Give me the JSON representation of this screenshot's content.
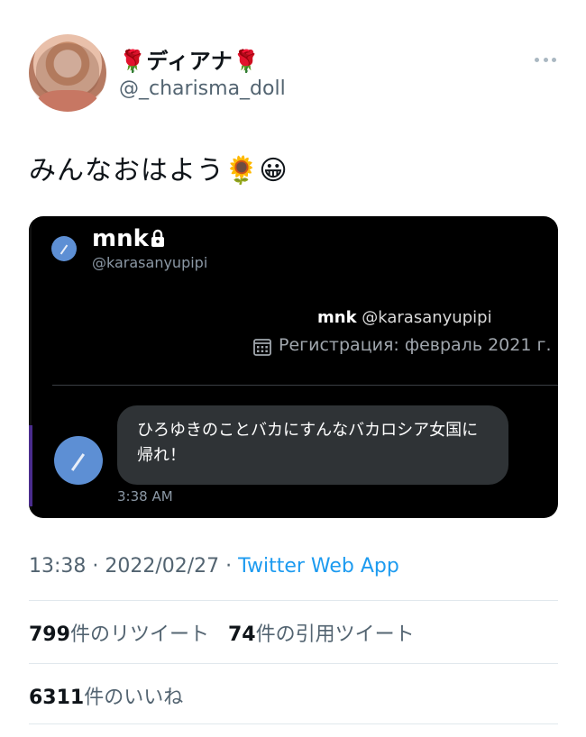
{
  "tweet": {
    "display_name": "🌹ディアナ🌹",
    "username": "@_charisma_doll",
    "text": "みんなおはよう🌻😀",
    "timestamp": "13:38 · 2022/02/27 · ",
    "source_app": "Twitter Web App"
  },
  "embed": {
    "name": "mnk",
    "handle": "@karasanyupipi",
    "profile_name": "mnk",
    "profile_handle": " @karasanyupipi",
    "registration": "Регистрация: февраль 2021 г.",
    "message": "ひろゆきのことバカにすんなバカロシア女国に帰れ！",
    "message_time": "3:38 AM"
  },
  "stats": {
    "retweets_count": "799",
    "retweets_label": "件のリツイート",
    "quotes_count": "74",
    "quotes_label": "件の引用ツイート",
    "likes_count": "6311",
    "likes_label": "件のいいね"
  },
  "icons": {
    "more": "more-dots-icon",
    "lock": "lock-icon",
    "calendar": "calendar-icon"
  },
  "colors": {
    "link": "#1d9bf0",
    "secondary_text": "#536471",
    "embed_bg": "#000000",
    "bubble_bg": "#2f3336"
  }
}
